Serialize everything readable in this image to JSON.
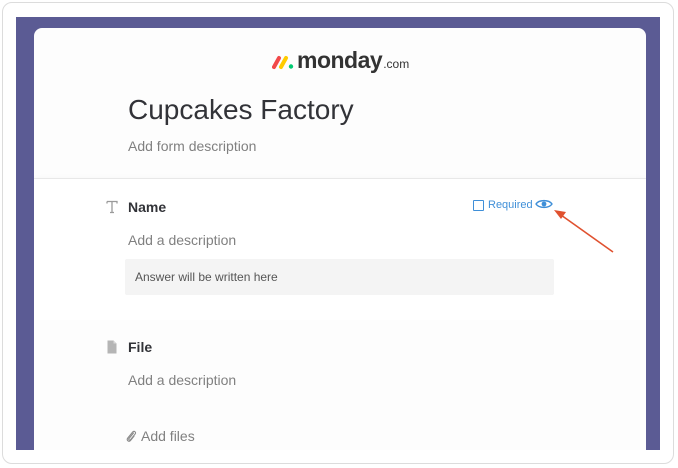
{
  "brand": {
    "name": "monday",
    "domain": ".com"
  },
  "form": {
    "title": "Cupcakes Factory",
    "description_placeholder": "Add form description"
  },
  "questions": [
    {
      "icon": "text-icon",
      "label": "Name",
      "description_placeholder": "Add a description",
      "answer_placeholder": "Answer will be written here",
      "required_label": "Required",
      "required": false
    },
    {
      "icon": "file-icon",
      "label": "File",
      "description_placeholder": "Add a description",
      "add_files_label": "Add files"
    }
  ],
  "colors": {
    "background": "#5b5b94",
    "accent": "#3f8fd8",
    "annotation_arrow": "#e0512f",
    "logo_red": "#f2494a",
    "logo_yellow": "#ffcb00",
    "logo_green": "#00ca72"
  }
}
